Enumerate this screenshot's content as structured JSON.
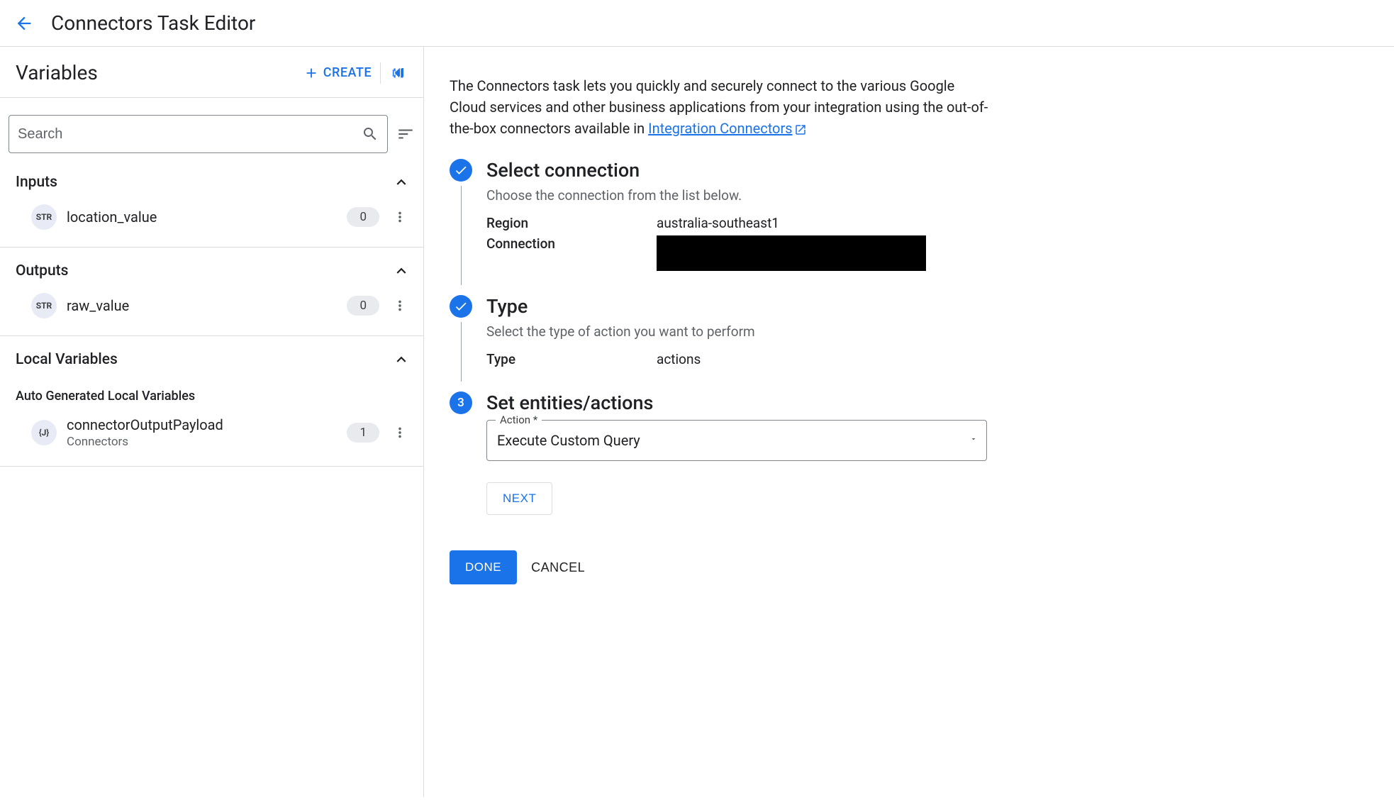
{
  "header": {
    "title": "Connectors Task Editor"
  },
  "sidebar": {
    "title": "Variables",
    "create_label": "CREATE",
    "search_placeholder": "Search",
    "sections": {
      "inputs": {
        "title": "Inputs",
        "items": [
          {
            "type": "STR",
            "name": "location_value",
            "count": "0"
          }
        ]
      },
      "outputs": {
        "title": "Outputs",
        "items": [
          {
            "type": "STR",
            "name": "raw_value",
            "count": "0"
          }
        ]
      },
      "local": {
        "title": "Local Variables",
        "auto_title": "Auto Generated Local Variables",
        "items": [
          {
            "type": "{J}",
            "name": "connectorOutputPayload",
            "sub": "Connectors",
            "count": "1"
          }
        ]
      }
    }
  },
  "main": {
    "intro": "The Connectors task lets you quickly and securely connect to the various Google Cloud services and other business applications from your integration using the out-of-the-box connectors available in ",
    "intro_link": "Integration Connectors",
    "steps": {
      "select_connection": {
        "title": "Select connection",
        "desc": "Choose the connection from the list below.",
        "region_label": "Region",
        "region_value": "australia-southeast1",
        "connection_label": "Connection"
      },
      "type": {
        "title": "Type",
        "desc": "Select the type of action you want to perform",
        "type_label": "Type",
        "type_value": "actions"
      },
      "entities": {
        "number": "3",
        "title": "Set entities/actions",
        "action_label": "Action *",
        "action_value": "Execute Custom Query",
        "next_label": "NEXT"
      }
    },
    "done_label": "DONE",
    "cancel_label": "CANCEL"
  }
}
